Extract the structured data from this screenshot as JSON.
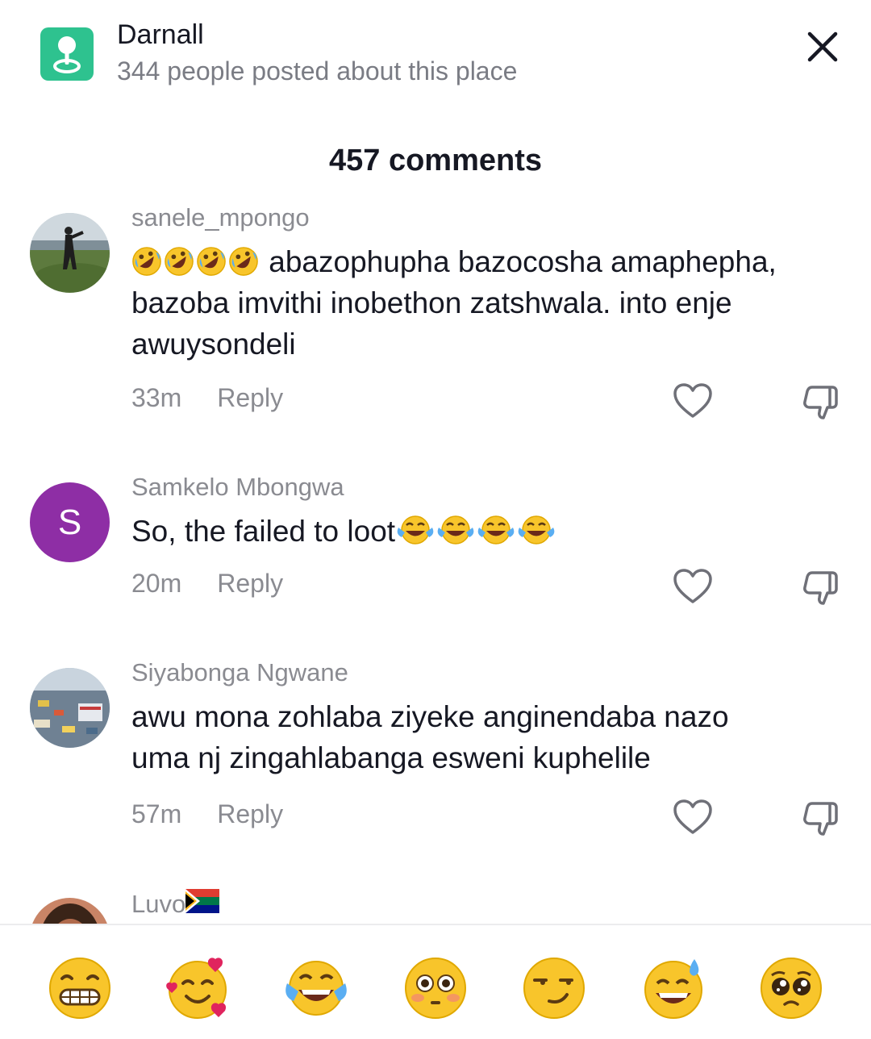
{
  "place": {
    "name": "Darnall",
    "subtitle": "344 people posted about this place",
    "icon": "map-pin-icon",
    "accent": "#2ec28f"
  },
  "comments_count": "457 comments",
  "comments": [
    {
      "username": "sanele_mpongo",
      "emoji_prefix": [
        "rofl",
        "rofl",
        "rofl",
        "rofl"
      ],
      "text_line1": "abazophupha bazocosha",
      "text_rest": "amaphepha, bazoba imvithi inobethon zatshwala. into enje awuysondeli",
      "time": "33m",
      "reply": "Reply"
    },
    {
      "username": "Samkelo Mbongwa",
      "avatar_letter": "S",
      "avatar_color": "#8e2ea5",
      "text": "So, the failed to loot",
      "emoji_suffix": [
        "joy",
        "joy",
        "joy",
        "joy"
      ],
      "time": "20m",
      "reply": "Reply"
    },
    {
      "username": "Siyabonga Ngwane",
      "text_line1": "awu mona zohlaba ziyeke anginendaba nazo",
      "text_line2": "uma nj zingahlabanga esweni kuphelile",
      "time": "57m",
      "reply": "Reply"
    },
    {
      "username": "Luvo",
      "flag": "south-africa-flag-icon"
    }
  ],
  "quick_emojis": [
    "grin",
    "smiling-face-with-hearts",
    "joy",
    "flushed",
    "smirk",
    "sweat-smile",
    "pleading"
  ]
}
